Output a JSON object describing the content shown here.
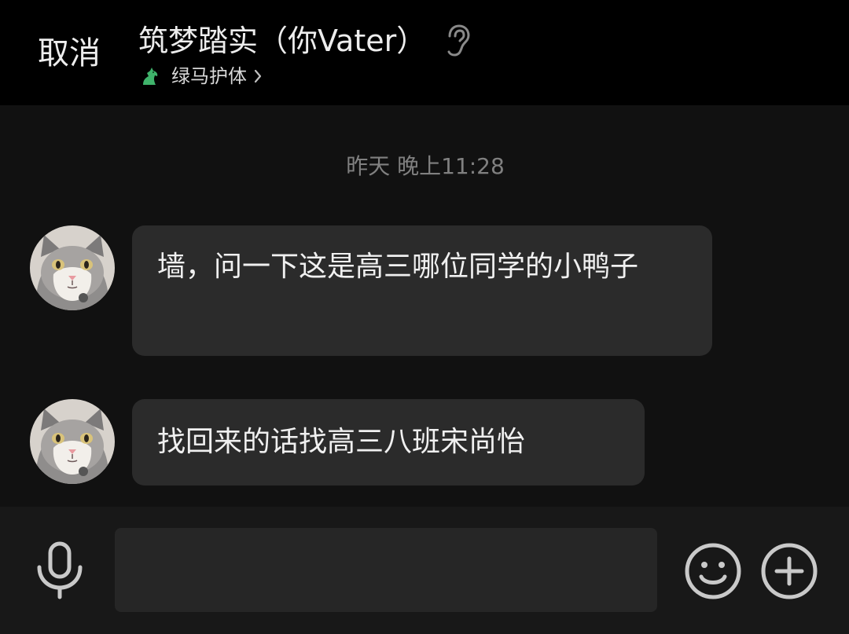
{
  "header": {
    "cancel_label": "取消",
    "title": "筑梦踏实（你Vater）",
    "subtitle": "绿马护体",
    "ear_icon": "ear-icon",
    "subtitle_icon": "horse-icon"
  },
  "chat": {
    "timestamp": "昨天 晚上11:28",
    "messages": [
      {
        "side": "left",
        "avatar": "cat-avatar",
        "text": "墙，问一下这是高三哪位同学的小鸭子"
      },
      {
        "side": "left",
        "avatar": "cat-avatar",
        "text": "找回来的话找高三八班宋尚怡"
      }
    ]
  },
  "input_bar": {
    "voice_icon": "microphone-icon",
    "message_value": "",
    "emoji_icon": "smiley-icon",
    "more_icon": "plus-icon"
  },
  "colors": {
    "header_bg": "#000000",
    "chat_bg": "#111111",
    "bubble_bg": "#2b2b2b",
    "input_bar_bg": "#181818",
    "input_field_bg": "#262626",
    "icon_gray": "#c9c9c9",
    "timestamp_gray": "#808080"
  }
}
